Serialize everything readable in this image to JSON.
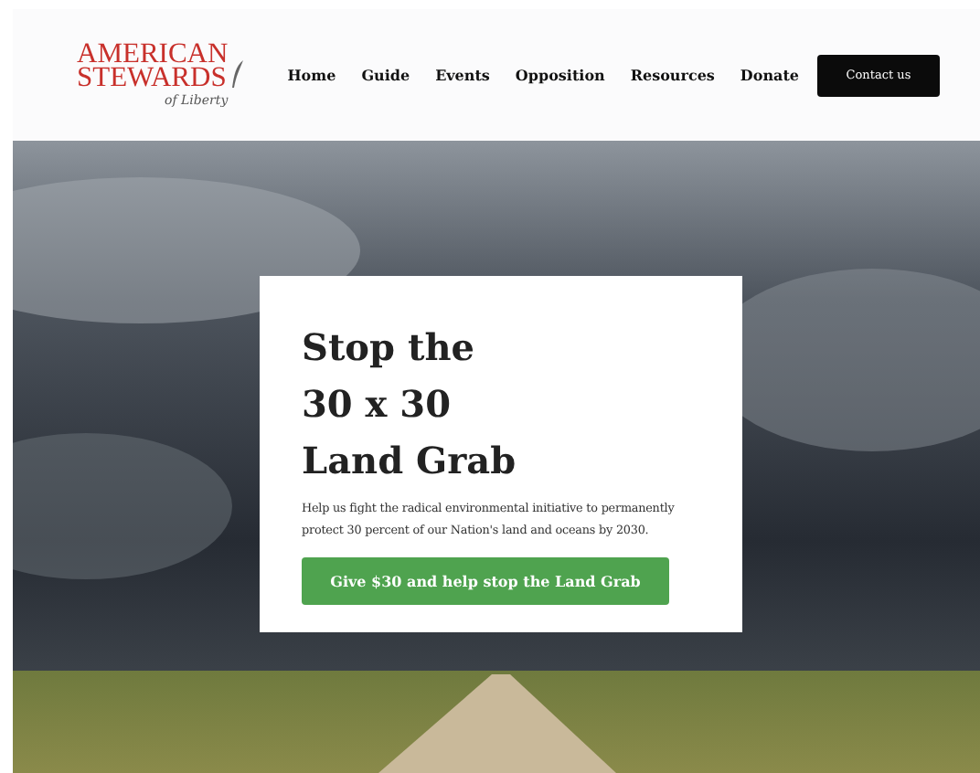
{
  "logo": {
    "lines": [
      "AMERICAN",
      "STEWARDS"
    ],
    "tagline": "of Liberty"
  },
  "nav": [
    {
      "label": "Home"
    },
    {
      "label": "Guide"
    },
    {
      "label": "Events"
    },
    {
      "label": "Opposition"
    },
    {
      "label": "Resources"
    },
    {
      "label": "Donate"
    }
  ],
  "contact_button": "Contact us",
  "hero": {
    "heading_lines": [
      "Stop the",
      "30 x 30",
      "Land Grab"
    ],
    "text": "Help us fight the radical environmental initiative to permanently protect 30 percent of our Nation's land and oceans by 2030.",
    "button": "Give $30 and help stop the Land Grab"
  }
}
